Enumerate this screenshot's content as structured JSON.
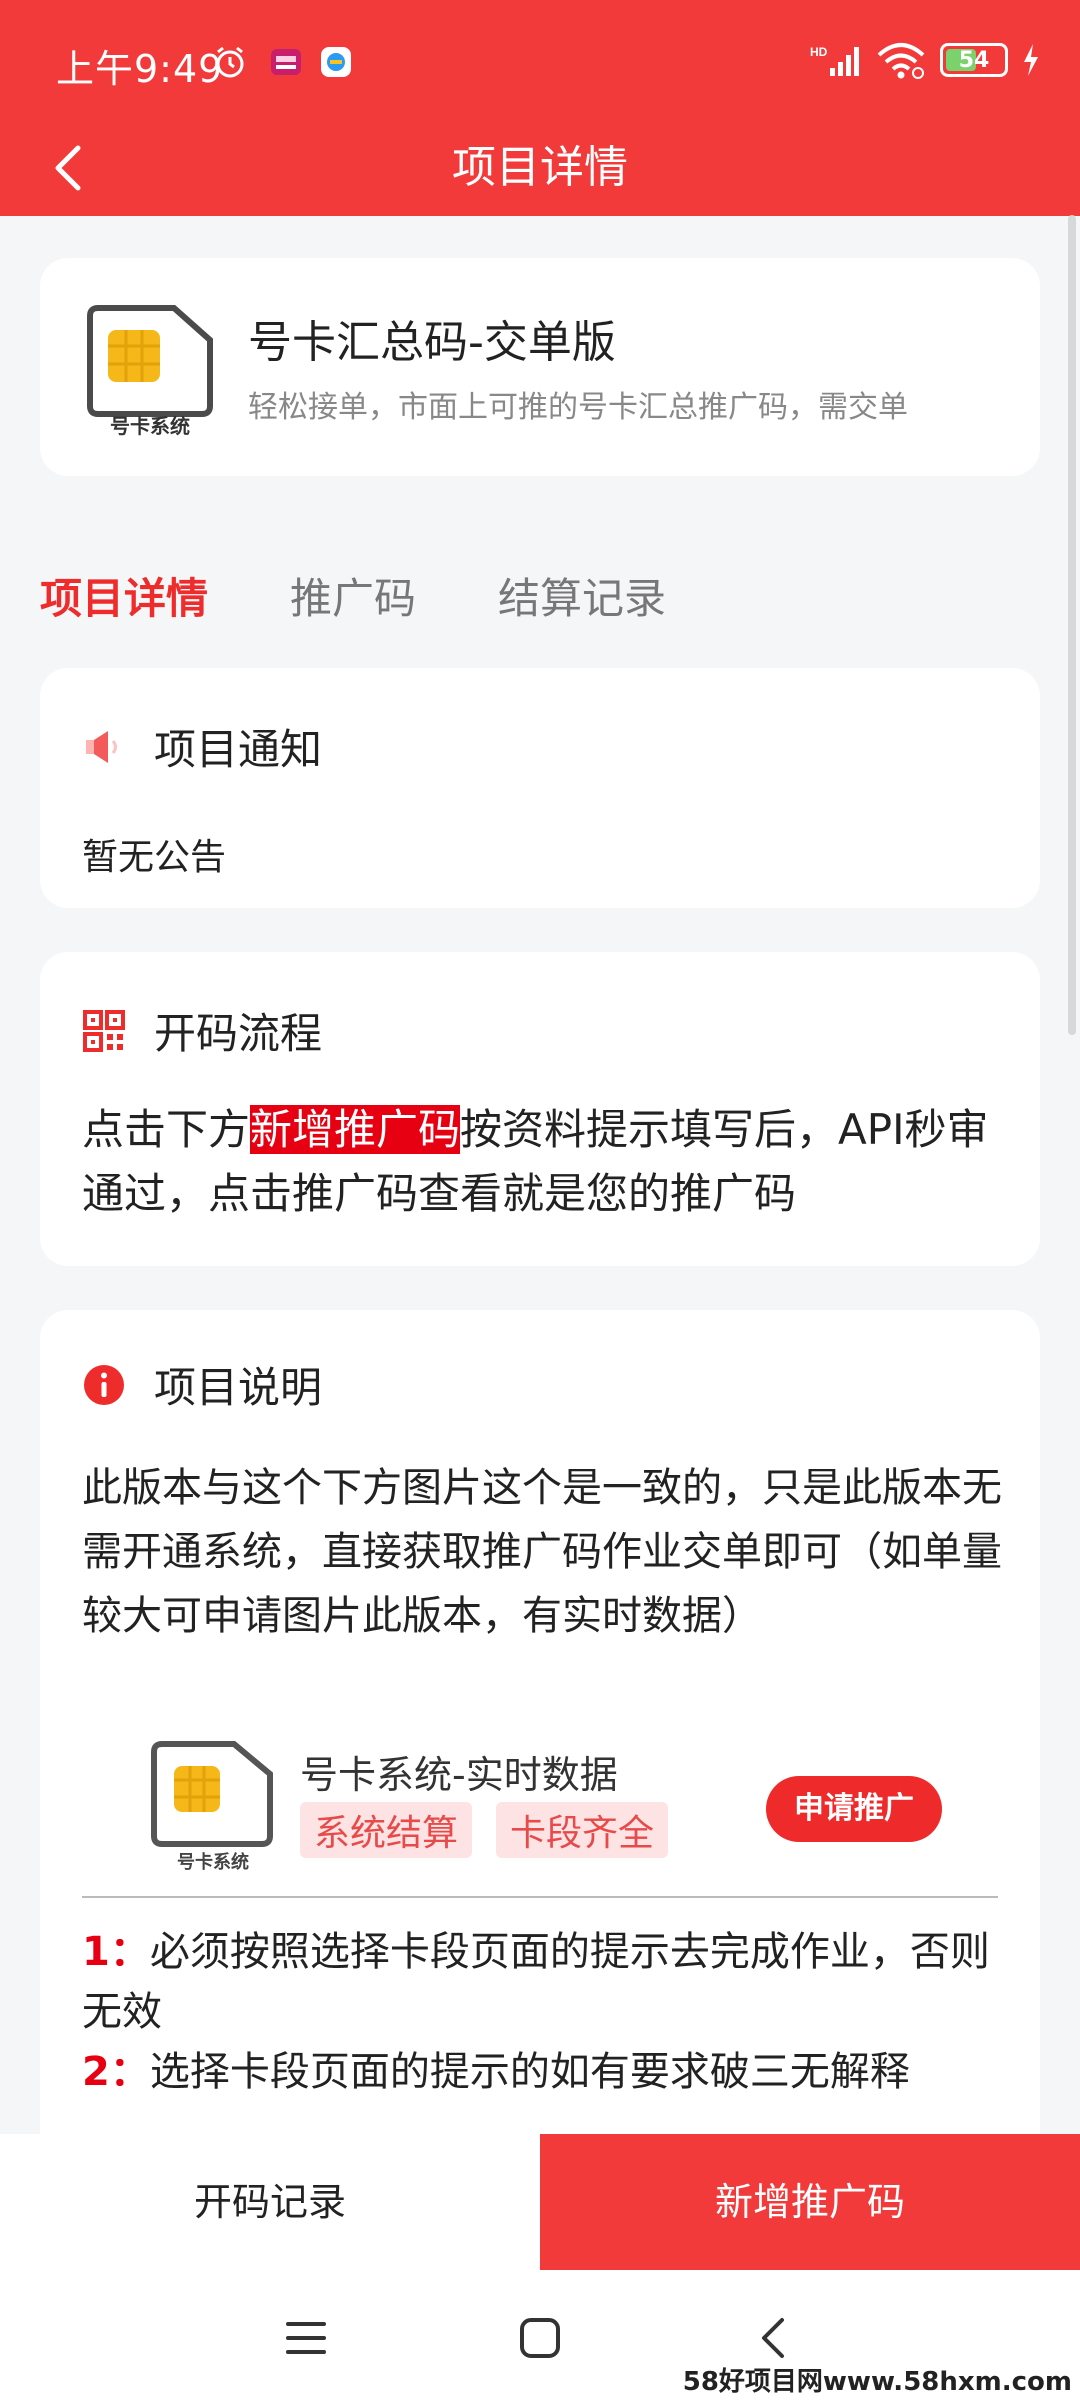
{
  "status_bar": {
    "time": "上午9:49",
    "battery": "54",
    "icons": [
      "alarm-icon",
      "app-notification-icon",
      "app-notification-icon",
      "hd-signal-icon",
      "wifi-icon",
      "battery-icon",
      "charging-icon"
    ]
  },
  "header": {
    "title": "项目详情",
    "back_icon": "chevron-left-icon"
  },
  "project": {
    "name": "号卡汇总码-交单版",
    "description": "轻松接单，市面上可推的号卡汇总推广码，需交单",
    "icon_caption": "号卡系统"
  },
  "tabs": [
    {
      "label": "项目详情",
      "active": true
    },
    {
      "label": "推广码",
      "active": false
    },
    {
      "label": "结算记录",
      "active": false
    }
  ],
  "notice": {
    "title": "项目通知",
    "text": "暂无公告"
  },
  "flow": {
    "title": "开码流程",
    "text_before": "点击下方",
    "text_highlight": "新增推广码",
    "text_after": "按资料提示填写后，API秒审通过，点击推广码查看就是您的推广码"
  },
  "description": {
    "title": "项目说明",
    "text": "此版本与这个下方图片这个是一致的，只是此版本无需开通系统，直接获取推广码作业交单即可（如单量较大可申请图片此版本，有实时数据）",
    "embed": {
      "icon_caption": "号卡系统",
      "title": "号卡系统-实时数据",
      "tags": [
        "系统结算",
        "卡段齐全"
      ],
      "button": "申请推广"
    },
    "rules": [
      {
        "num": "1：",
        "text": "必须按照选择卡段页面的提示去完成作业，否则无效"
      },
      {
        "num": "2：",
        "text": "选择卡段页面的提示的如有要求破三无解释"
      }
    ]
  },
  "actions": {
    "record": "开码记录",
    "add": "新增推广码"
  },
  "watermark": "58好项目网www.58hxm.com",
  "colors": {
    "brand_red": "#f23a3a",
    "highlight_red": "#e60012",
    "page_bg": "#f5f6f8"
  }
}
